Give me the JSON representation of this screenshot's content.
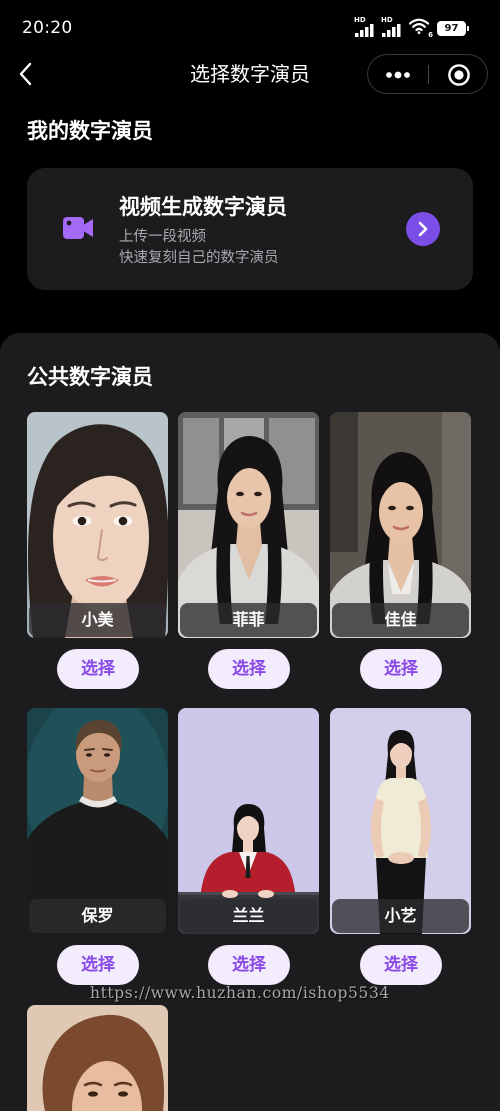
{
  "status_bar": {
    "time": "20:20",
    "sim1_label": "HD",
    "sim2_label": "HD",
    "wifi_badge": "6",
    "battery": "97"
  },
  "nav": {
    "title": "选择数字演员"
  },
  "my_section": {
    "title": "我的数字演员",
    "card": {
      "title": "视频生成数字演员",
      "subtitle_line1": "上传一段视频",
      "subtitle_line2": "快速复刻自己的数字演员"
    }
  },
  "public_section": {
    "title": "公共数字演员",
    "select_label": "选择",
    "actors": [
      {
        "name": "小美"
      },
      {
        "name": "菲菲"
      },
      {
        "name": "佳佳"
      },
      {
        "name": "保罗"
      },
      {
        "name": "兰兰"
      },
      {
        "name": "小艺"
      }
    ]
  },
  "watermark": "https://www.huzhan.com/ishop5534",
  "icons": {
    "back": "chevron-left-icon",
    "more": "more-dots-icon",
    "close_mini_program": "target-icon",
    "video_generate": "video-camera-icon",
    "enter": "chevron-right-icon",
    "signal": "signal-icon",
    "wifi": "wifi-icon",
    "battery": "battery-icon"
  },
  "colors": {
    "page_bg": "#000000",
    "panel_bg": "#1c1c1e",
    "accent": "#7c4ee8",
    "video_icon": "#a569f7",
    "select_button_bg": "#f3ecfd",
    "select_button_text": "#8a4ae6"
  }
}
